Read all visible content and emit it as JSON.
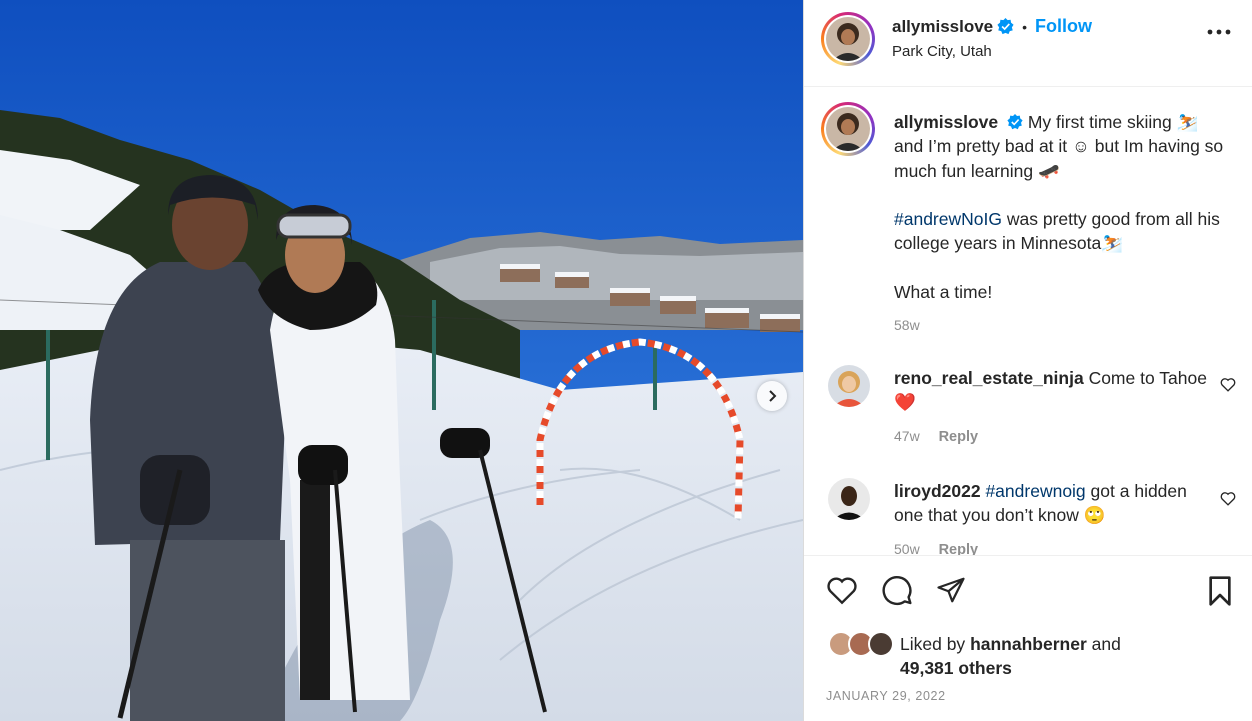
{
  "post": {
    "username": "allymisslove",
    "follow_label": "Follow",
    "separator": "•",
    "location": "Park City, Utah",
    "date": "JANUARY 29, 2022"
  },
  "caption": {
    "username": "allymisslove",
    "line1_text": "My first time skiing",
    "line1_emoji": "⛷️",
    "line2": "and I’m pretty bad at it ☺ but Im having so much fun learning",
    "line2_emoji": "🛹",
    "hashtag": "#andrewNoIG",
    "line3": "was pretty good from all his college years in Minnesota",
    "line3_emoji": "⛷️",
    "line4": "What a time!",
    "age": "58w"
  },
  "comments": [
    {
      "username": "reno_real_estate_ninja",
      "text": "Come to Tahoe",
      "emoji": "❤️",
      "age": "47w",
      "reply_label": "Reply"
    },
    {
      "username": "liroyd2022",
      "hashtag": "#andrewnoig",
      "text": "got a hidden one that you don’t know",
      "emoji": "🙄",
      "age": "50w",
      "reply_label": "Reply"
    }
  ],
  "likes": {
    "prefix": "Liked by",
    "first_liker": "hannahberner",
    "and": "and",
    "others": "49,381 others"
  },
  "colors": {
    "accent": "#0095f6",
    "hashtag": "#00376b",
    "muted": "#8e8e8e",
    "text": "#262626",
    "sky": "#1a5fc7"
  },
  "icons": [
    "verified-badge-icon",
    "more-options-icon",
    "heart-icon",
    "comment-icon",
    "share-icon",
    "bookmark-icon",
    "chevron-right-icon"
  ]
}
